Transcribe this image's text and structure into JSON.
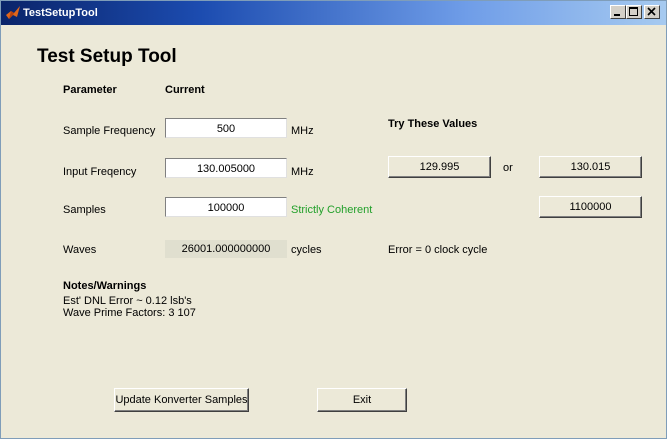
{
  "window": {
    "title": "TestSetupTool"
  },
  "heading": "Test Setup Tool",
  "columns": {
    "parameter": "Parameter",
    "current": "Current",
    "try": "Try These Values"
  },
  "rows": {
    "sample_frequency": {
      "label": "Sample Frequency",
      "value": "500",
      "unit": "MHz"
    },
    "input_frequency": {
      "label": "Input Freqency",
      "value": "130.005000",
      "unit": "MHz",
      "try_low": "129.995",
      "or_text": "or",
      "try_high": "130.015"
    },
    "samples": {
      "label": "Samples",
      "value": "100000",
      "status": "Strictly Coherent",
      "try_value": "1100000"
    },
    "waves": {
      "label": "Waves",
      "value": "26001.000000000",
      "unit": "cycles",
      "error": "Error = 0 clock cycle"
    }
  },
  "notes": {
    "title": "Notes/Warnings",
    "lines": [
      "Est' DNL Error ~ 0.12 lsb's",
      "Wave Prime Factors:  3  107"
    ]
  },
  "buttons": {
    "update": "Update Konverter Samples",
    "exit": "Exit"
  },
  "colors": {
    "status_green": "#22a02a",
    "titlebar_start": "#0a246a",
    "titlebar_end": "#a6caf0"
  },
  "icons": {
    "app": "matlab-icon",
    "minimize": "minimize-icon",
    "maximize": "maximize-icon",
    "close": "close-icon"
  }
}
